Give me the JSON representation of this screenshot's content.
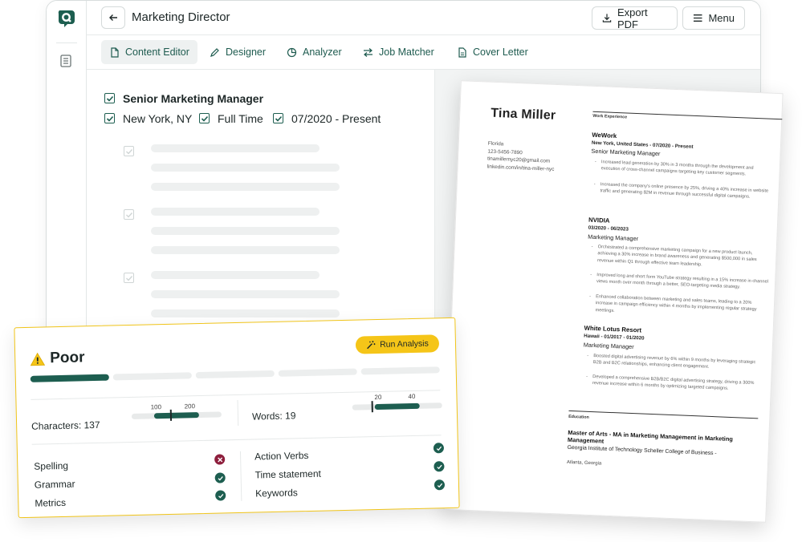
{
  "window": {
    "title": "Marketing Director"
  },
  "toolbar": {
    "export_label": "Export PDF",
    "menu_label": "Menu"
  },
  "tabs": [
    {
      "label": "Content Editor",
      "icon": "file-icon",
      "active": true
    },
    {
      "label": "Designer",
      "icon": "pen-icon"
    },
    {
      "label": "Analyzer",
      "icon": "pie-icon"
    },
    {
      "label": "Job Matcher",
      "icon": "arrows-icon"
    },
    {
      "label": "Cover Letter",
      "icon": "document-icon"
    }
  ],
  "editor": {
    "title": "Senior Marketing Manager",
    "location": "New York, NY",
    "type": "Full Time",
    "dates": "07/2020 - Present"
  },
  "resume": {
    "name": "Tina Miller",
    "contact": [
      "Florida",
      "123-5456-7890",
      "tinamillernyc20@gmail.com",
      "linkedin.com/in/tina-miller-nyc"
    ],
    "work_heading": "Work Experience",
    "jobs": [
      {
        "company": "WeWork",
        "location_dates": "New York, United States - 07/2020 - Present",
        "role": "Senior Marketing Manager",
        "bullets": [
          "Increased lead generation by 30% in 3 months through the development and execution of cross-channel campaigns targeting key customer segments.",
          "Increased the company's online presence by 25%, driving a 40% increase in website traffic and generating $2M in revenue through successful digital campaigns."
        ]
      },
      {
        "company": "NVIDIA",
        "location_dates": "03/2020 - 06/2023",
        "role": "Marketing Manager",
        "bullets": [
          "Orchestrated a comprehensive marketing campaign for a new product launch, achieving a 30% increase in brand awareness and generating $500,000 in sales revenue within Q1 through effective team leadership.",
          "Improved long and short form YouTube strategy resulting in a 15% increase in channel views month over month through a better, SEO-targeting media strategy.",
          "Enhanced collaboration between marketing and sales teams, leading to a 20% increase in campaign efficiency within 4 months by implementing regular strategy meetings."
        ]
      },
      {
        "company": "White Lotus Resort",
        "location_dates": "Hawaii - 01/2017 - 01/2020",
        "role": "Marketing Manager",
        "bullets": [
          "Boosted digital advertising revenue by 6% within 9 months by leveraging strategic B2B and B2C relationships, enhancing client engagement.",
          "Developed a comprehensive B2B/B2C digital advertising strategy, driving a 300% revenue increase within 6 months by optimizing targeted campaigns."
        ]
      }
    ],
    "edu_heading": "Education",
    "degree": "Master of Arts - MA in Marketing Management in Marketing Management",
    "school": "Georgia Institute of Technology Scheller College of Business -",
    "school_location": "Atlanta, Georgia"
  },
  "analysis": {
    "score": "Poor",
    "run_label": "Run Analysis",
    "filled_segments": 1,
    "total_segments": 5,
    "characters": {
      "label": "Characters: 137",
      "min_label": "100",
      "max_label": "200",
      "min": 100,
      "max": 200,
      "value": 137
    },
    "words": {
      "label": "Words: 19",
      "min_label": "20",
      "max_label": "40",
      "min": 20,
      "max": 40,
      "value": 19
    },
    "checks_left": [
      {
        "label": "Spelling",
        "status": "fail"
      },
      {
        "label": "Grammar",
        "status": "pass"
      },
      {
        "label": "Metrics",
        "status": "pass"
      }
    ],
    "checks_right": [
      {
        "label": "Action Verbs",
        "status": "pass"
      },
      {
        "label": "Time statement",
        "status": "pass"
      },
      {
        "label": "Keywords",
        "status": "pass"
      }
    ]
  },
  "colors": {
    "brand": "#1d5e50",
    "accent": "#f5c518",
    "fail": "#8e1f3d"
  }
}
